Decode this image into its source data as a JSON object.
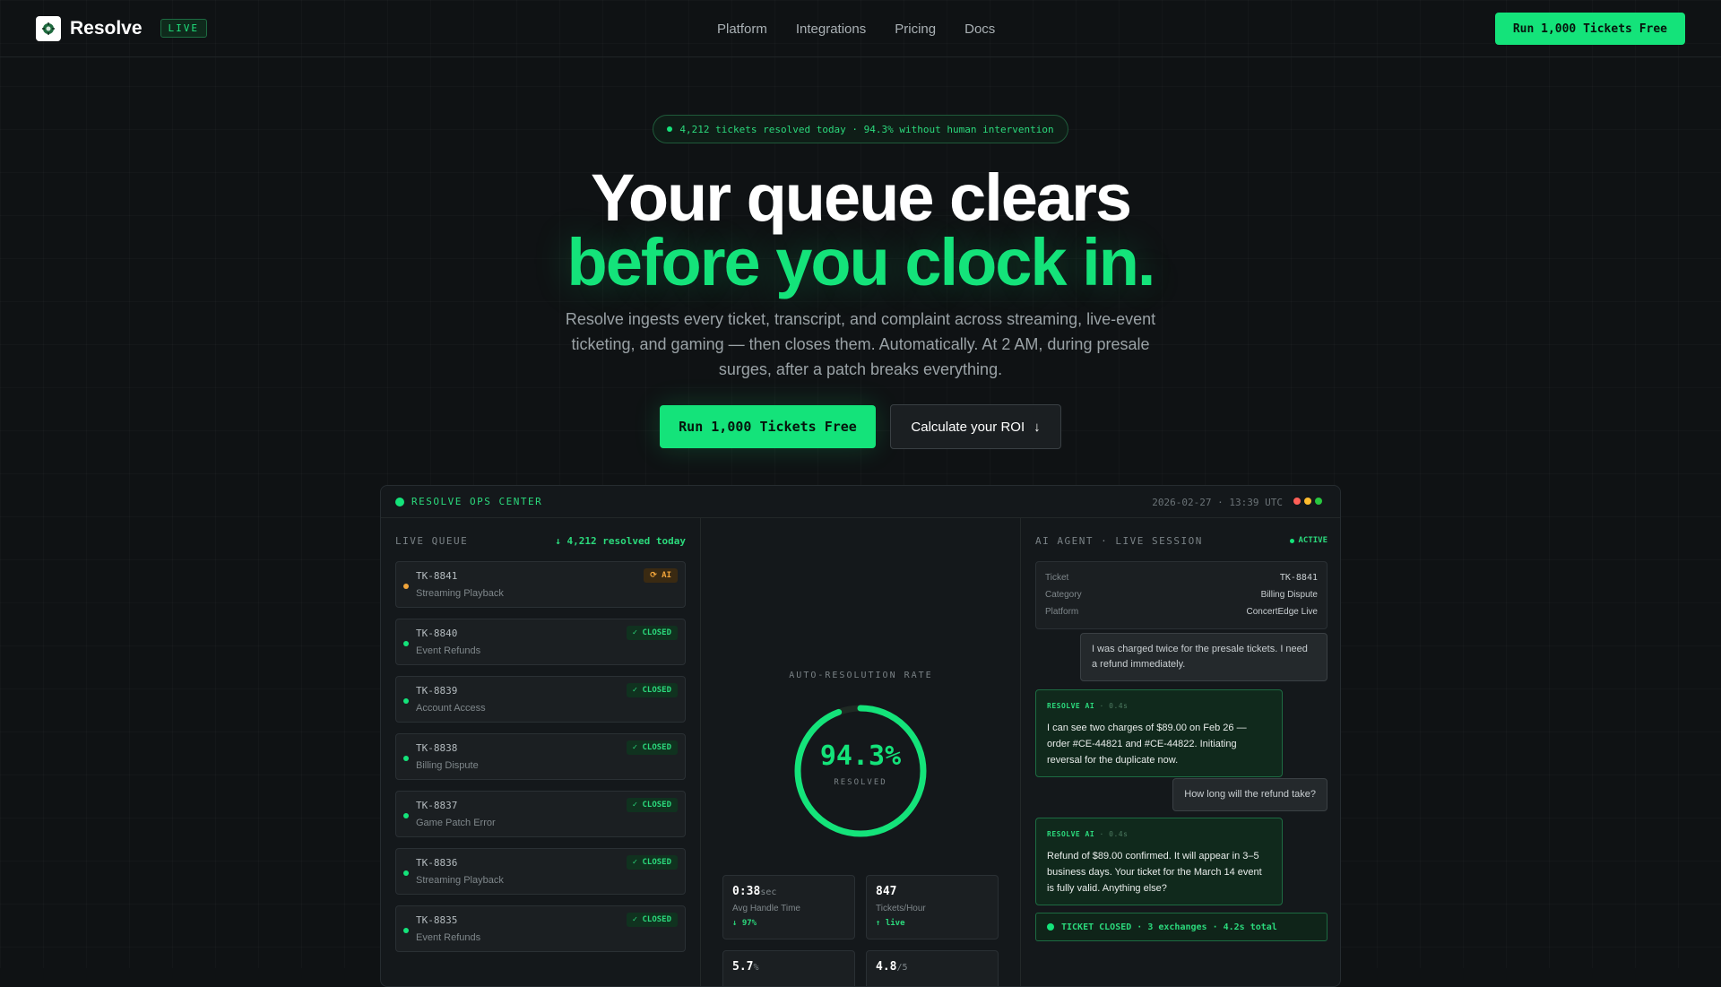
{
  "nav": {
    "brand": "Resolve",
    "live_badge": "LIVE",
    "links": [
      "Platform",
      "Integrations",
      "Pricing",
      "Docs"
    ],
    "cta": "Run 1,000 Tickets Free"
  },
  "hero": {
    "stats_pill": "4,212 tickets resolved today · 94.3% without human intervention",
    "headline_line1": "Your queue clears",
    "headline_line2": "before you clock in.",
    "subtitle": "Resolve ingests every ticket, transcript, and complaint across streaming, live-event ticketing, and gaming — then closes them. Automatically. At 2 AM, during presale surges, after a patch breaks everything.",
    "primary_cta": "Run 1,000 Tickets Free",
    "secondary_cta": "Calculate your ROI",
    "secondary_cta_icon": "↓"
  },
  "dashboard": {
    "title": "RESOLVE OPS CENTER",
    "timestamp": "2026-02-27 · 13:39 UTC",
    "window_dot_colors": [
      "#ff5f57",
      "#febc2e",
      "#28c840"
    ],
    "live_queue": {
      "label": "LIVE QUEUE",
      "resolved_today": "↓ 4,212 resolved today",
      "items": [
        {
          "id": "TK-8841",
          "category": "Streaming Playback",
          "status": "⟳ AI",
          "kind": "ai"
        },
        {
          "id": "TK-8840",
          "category": "Event Refunds",
          "status": "✓ CLOSED",
          "kind": "closed"
        },
        {
          "id": "TK-8839",
          "category": "Account Access",
          "status": "✓ CLOSED",
          "kind": "closed"
        },
        {
          "id": "TK-8838",
          "category": "Billing Dispute",
          "status": "✓ CLOSED",
          "kind": "closed"
        },
        {
          "id": "TK-8837",
          "category": "Game Patch Error",
          "status": "✓ CLOSED",
          "kind": "closed"
        },
        {
          "id": "TK-8836",
          "category": "Streaming Playback",
          "status": "✓ CLOSED",
          "kind": "closed"
        },
        {
          "id": "TK-8835",
          "category": "Event Refunds",
          "status": "✓ CLOSED",
          "kind": "closed"
        }
      ]
    },
    "center": {
      "label": "AUTO-RESOLUTION RATE",
      "rate": "94.3%",
      "rate_value": 94.3,
      "rate_caption": "RESOLVED",
      "metrics": [
        {
          "value": "0:38",
          "unit": "sec",
          "label": "Avg Handle Time",
          "delta": "↓ 97%"
        },
        {
          "value": "847",
          "unit": "",
          "label": "Tickets/Hour",
          "delta": "↑ live"
        },
        {
          "value": "5.7",
          "unit": "%",
          "label": "",
          "delta": ""
        },
        {
          "value": "4.8",
          "unit": "/5",
          "label": "",
          "delta": ""
        }
      ]
    },
    "agent": {
      "label": "AI AGENT · LIVE SESSION",
      "status": "ACTIVE",
      "ticket_info": [
        {
          "key": "Ticket",
          "value": "TK-8841"
        },
        {
          "key": "Category",
          "value": "Billing Dispute"
        },
        {
          "key": "Platform",
          "value": "ConcertEdge Live"
        }
      ],
      "messages": [
        {
          "role": "user",
          "text": "I was charged twice for the presale tickets. I need a refund immediately."
        },
        {
          "role": "ai",
          "tag": "RESOLVE AI",
          "time": "· 0.4s",
          "text": "I can see two charges of $89.00 on Feb 26 — order #CE-44821 and #CE-44822. Initiating reversal for the duplicate now."
        },
        {
          "role": "user",
          "text": "How long will the refund take?"
        },
        {
          "role": "ai",
          "tag": "RESOLVE AI",
          "time": "· 0.4s",
          "text": "Refund of $89.00 confirmed. It will appear in 3–5 business days. Your ticket for the March 14 event is fully valid. Anything else?"
        }
      ],
      "closed_bar": "TICKET CLOSED · 3 exchanges · 4.2s total"
    }
  },
  "colors": {
    "accent": "#14e37a",
    "background": "#0f1214",
    "ai_status": "#f0a43a"
  }
}
